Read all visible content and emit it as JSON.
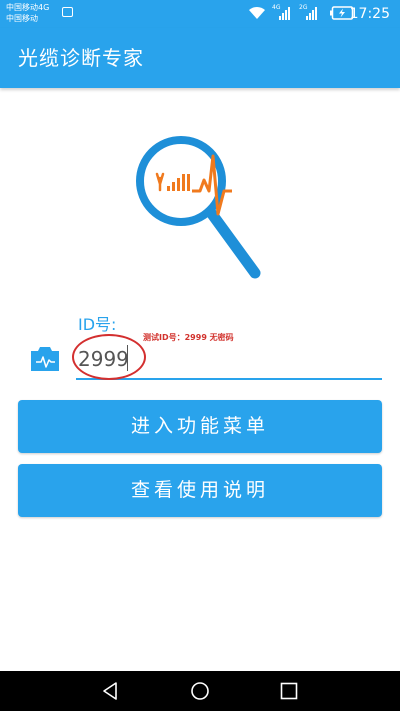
{
  "status_bar": {
    "carrier_1": "中国移动4G",
    "carrier_2": "中国移动",
    "net_1": "4G",
    "net_2": "2G",
    "time": "17:25",
    "icons": [
      "sim-icon",
      "wifi-icon",
      "signal-icon",
      "battery-charging-icon"
    ]
  },
  "app_bar": {
    "title": "光缆诊断专家"
  },
  "form": {
    "id_label": "ID号:",
    "id_value": "2999",
    "test_note": "测试ID号：2999  无密码"
  },
  "buttons": {
    "enter_menu": "进入功能菜单",
    "view_instructions": "查看使用说明"
  },
  "navigation": {
    "icons": [
      "back-icon",
      "home-icon",
      "recent-apps-icon"
    ]
  },
  "colors": {
    "primary": "#29a3ec",
    "accent_orange": "#f07a1e",
    "annotation_red": "#d32f2f"
  }
}
